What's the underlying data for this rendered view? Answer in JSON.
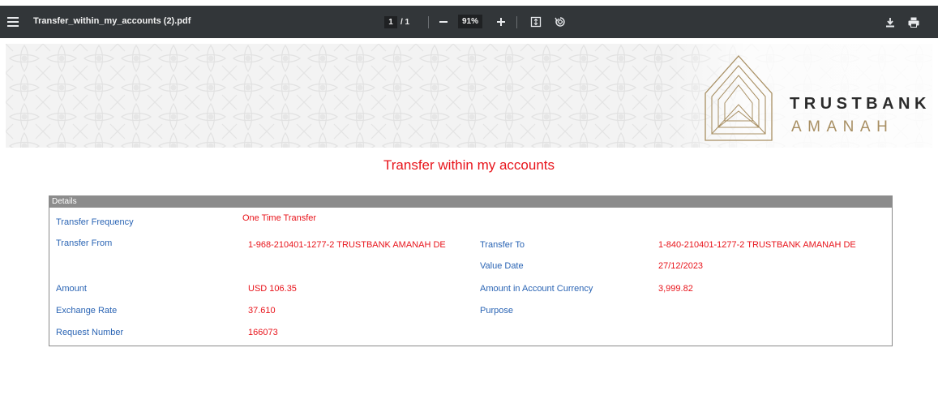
{
  "toolbar": {
    "filename": "Transfer_within_my_accounts (2).pdf",
    "current_page": "1",
    "page_total": "/ 1",
    "zoom": "91%"
  },
  "banner": {
    "brand_name": "TRUSTBANK",
    "brand_sub": "AMANAH"
  },
  "document": {
    "title": "Transfer within my accounts",
    "section_header": "Details",
    "fields": {
      "transfer_frequency_label": "Transfer Frequency",
      "transfer_frequency_value": "One Time Transfer",
      "transfer_from_label": "Transfer From",
      "transfer_from_value": "1-968-210401-1277-2  TRUSTBANK AMANAH DE",
      "transfer_to_label": "Transfer To",
      "transfer_to_value": "1-840-210401-1277-2  TRUSTBANK AMANAH DE",
      "value_date_label": "Value Date",
      "value_date_value": "27/12/2023",
      "amount_label": "Amount",
      "amount_value": "USD  106.35",
      "amount_account_currency_label": "Amount in Account Currency",
      "amount_account_currency_value": "3,999.82",
      "exchange_rate_label": "Exchange Rate",
      "exchange_rate_value": "37.610",
      "purpose_label": "Purpose",
      "request_number_label": "Request Number",
      "request_number_value": "166073"
    }
  },
  "colors": {
    "toolbar_bg": "#323639",
    "label_blue": "#2a64b4",
    "value_red": "#e8141b",
    "panel_header_gray": "#8c8c8c",
    "brand_gold": "#a88f63"
  }
}
